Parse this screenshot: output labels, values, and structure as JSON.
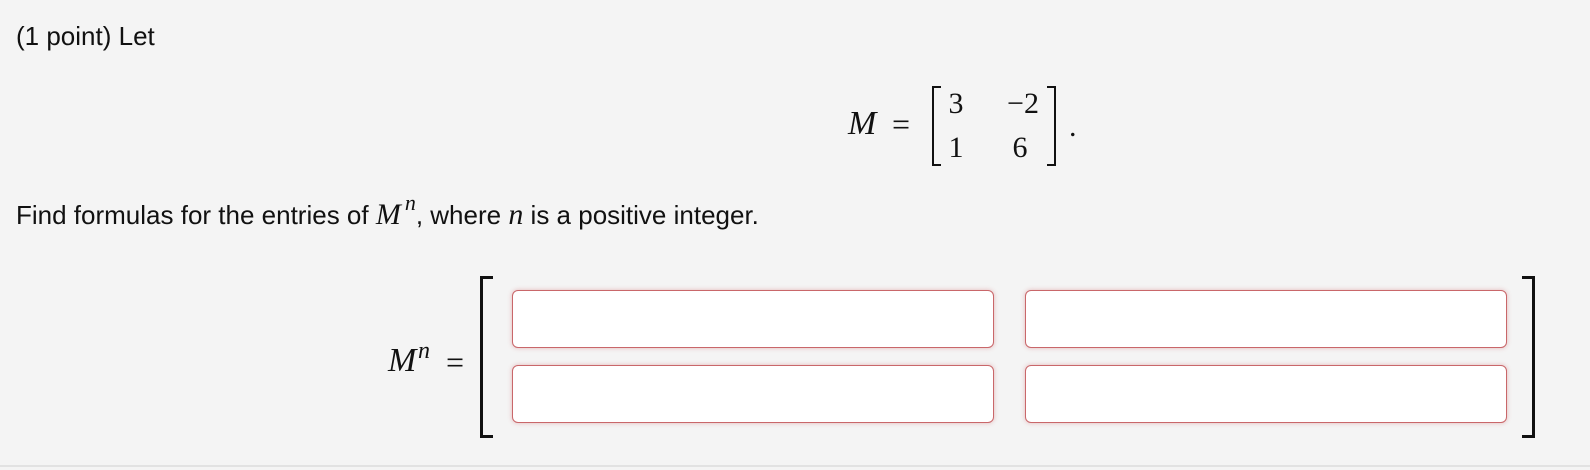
{
  "problem": {
    "points_label": "(1 point) Let",
    "matrix_symbol": "M",
    "equals": "=",
    "matrix_entries": [
      "3",
      "−2",
      "1",
      "6"
    ],
    "period": ".",
    "question": {
      "part1": "Find formulas for the entries of ",
      "symbol": "M",
      "exponent": "n",
      "part2": ", where ",
      "variable": "n",
      "part3": " is a positive integer."
    }
  },
  "answer": {
    "symbol": "M",
    "exponent": "n",
    "equals": "=",
    "inputs": [
      {
        "value": "",
        "placeholder": ""
      },
      {
        "value": "",
        "placeholder": ""
      },
      {
        "value": "",
        "placeholder": ""
      },
      {
        "value": "",
        "placeholder": ""
      }
    ]
  },
  "colors": {
    "background": "#f4f4f4",
    "input_border": "#c9676a",
    "input_background": "#ffffff"
  }
}
